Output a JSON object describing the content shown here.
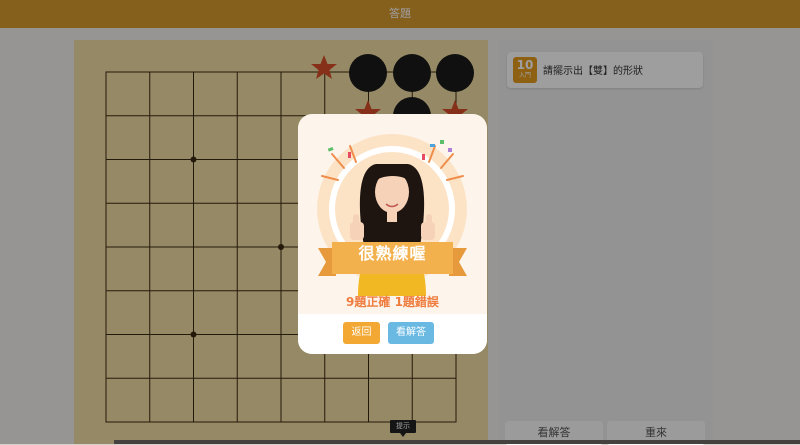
{
  "header": {
    "title": "答題"
  },
  "question": {
    "number": "10",
    "level": "入門",
    "text": "請擺示出【雙】的形狀"
  },
  "side_buttons": {
    "left": "看解答",
    "right": "重來"
  },
  "tooltip": "提示",
  "result": {
    "title": "很熟練喔",
    "score": "9題正確 1題錯誤"
  },
  "actions": {
    "back": "返回",
    "view_answer": "看解答"
  },
  "colors": {
    "header": "#d7992e",
    "board": "#f3dea4",
    "accent": "#ee7d3f",
    "back_button": "#f2a833",
    "answer_button": "#6ab9e3"
  }
}
